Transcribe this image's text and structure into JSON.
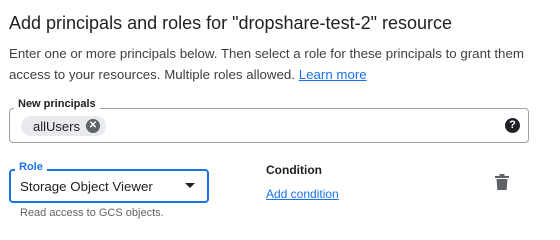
{
  "header": {
    "title": "Add principals and roles for \"dropshare-test-2\" resource"
  },
  "description": {
    "text": "Enter one or more principals below. Then select a role for these principals to grant them access to your resources. Multiple roles allowed. ",
    "link": "Learn more"
  },
  "principals": {
    "label": "New principals",
    "chips": [
      {
        "label": "allUsers",
        "remove_icon": "close-circle-icon"
      }
    ],
    "help_icon": "help-icon"
  },
  "role": {
    "label": "Role",
    "selected": "Storage Object Viewer",
    "helper": "Read access to GCS objects."
  },
  "condition": {
    "label": "Condition",
    "add_link": "Add condition"
  },
  "colors": {
    "accent": "#1a73e8",
    "text": "#202124",
    "muted": "#5f6368",
    "chip_bg": "#e8eaed"
  }
}
